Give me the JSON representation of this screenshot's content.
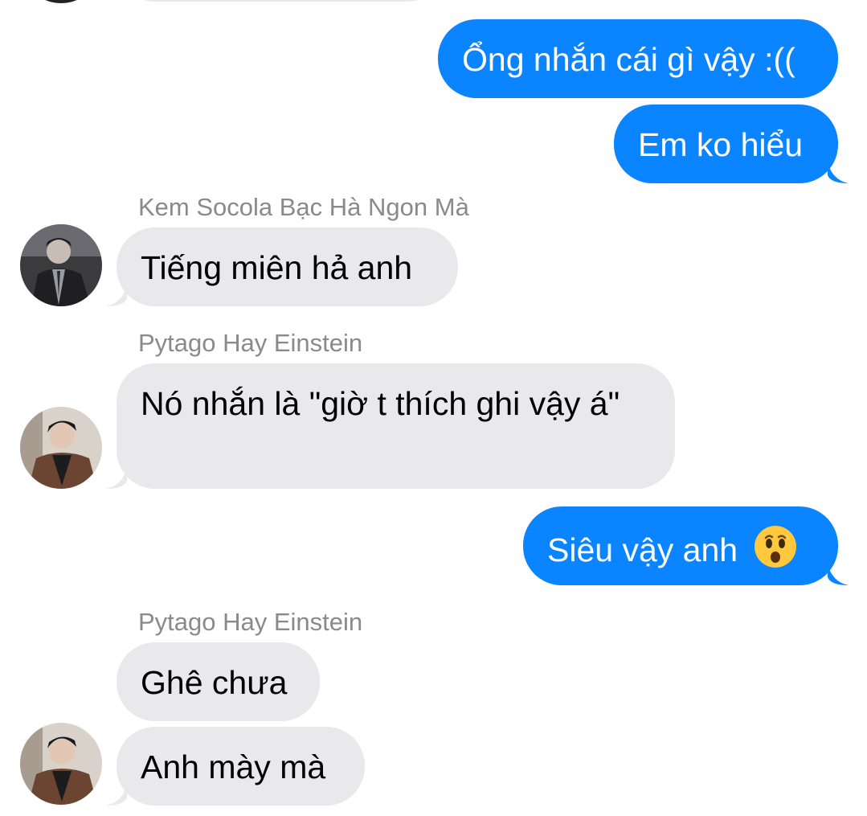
{
  "messages": [
    {
      "id": "m1",
      "direction": "out",
      "text": "Ổng nhắn cái gì vậy :(("
    },
    {
      "id": "m2",
      "direction": "out",
      "text": "Em ko hiểu"
    },
    {
      "id": "m3",
      "direction": "in",
      "sender": "Kem Socola Bạc Hà Ngon Mà",
      "text": "Tiếng miên hả anh"
    },
    {
      "id": "m4",
      "direction": "in",
      "sender": "Pytago Hay Einstein",
      "text": "Nó nhắn là \"giờ t thích ghi vậy á\""
    },
    {
      "id": "m5",
      "direction": "out",
      "text": "Siêu vậy anh",
      "emoji": "astonished-face"
    },
    {
      "id": "m6",
      "direction": "in",
      "sender": "Pytago Hay Einstein",
      "text": "Ghê chưa"
    },
    {
      "id": "m7",
      "direction": "in",
      "text": "Anh mày mà"
    }
  ],
  "colors": {
    "outgoing_bubble": "#0a84ff",
    "incoming_bubble": "#e9e9eb",
    "sender_name": "#8a8a8e"
  }
}
